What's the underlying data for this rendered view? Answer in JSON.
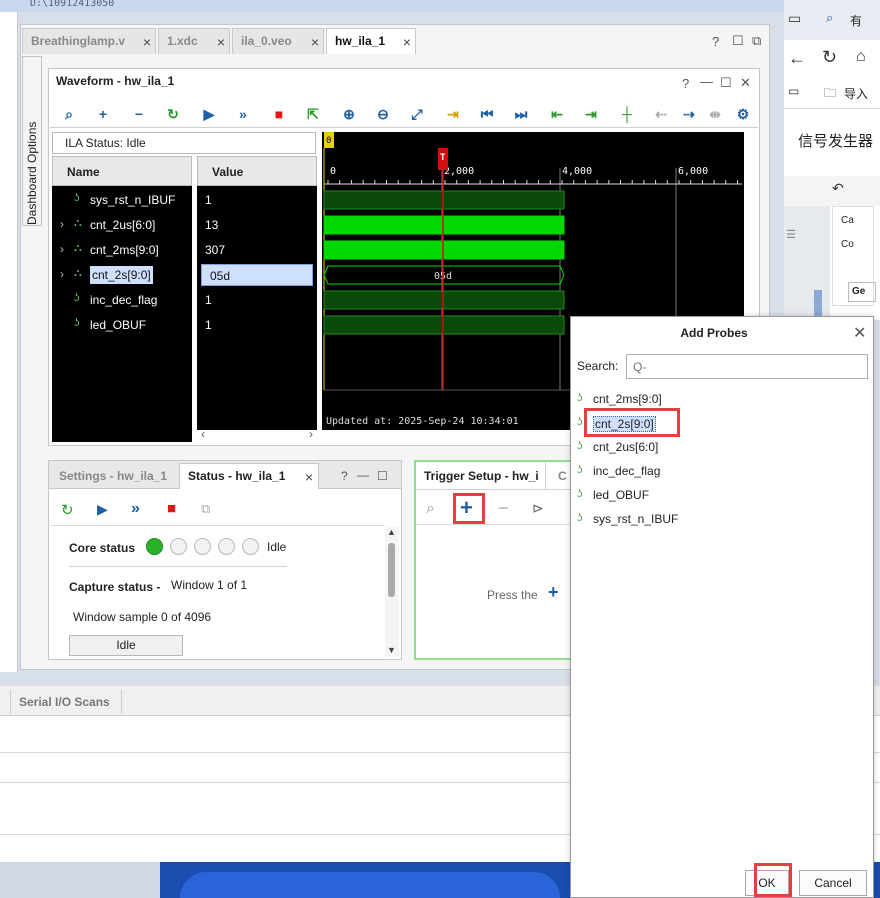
{
  "window": {
    "title_fragment": "D:\\10912413050"
  },
  "tabs": [
    {
      "label": "Breathinglamp.v"
    },
    {
      "label": "1.xdc"
    },
    {
      "label": "ila_0.veo"
    },
    {
      "label": "hw_ila_1"
    }
  ],
  "sidebar": {
    "dashboard_label": "Dashboard Options"
  },
  "waveform": {
    "title": "Waveform - hw_ila_1",
    "ila_status": "ILA Status: Idle",
    "name_header": "Name",
    "value_header": "Value",
    "signals": [
      {
        "name": "sys_rst_n_IBUF",
        "value": "1",
        "expandable": false
      },
      {
        "name": "cnt_2us[6:0]",
        "value": "13",
        "expandable": true
      },
      {
        "name": "cnt_2ms[9:0]",
        "value": "307",
        "expandable": true
      },
      {
        "name": "cnt_2s[9:0]",
        "value": "05d",
        "expandable": true
      },
      {
        "name": "inc_dec_flag",
        "value": "1",
        "expandable": false
      },
      {
        "name": "led_OBUF",
        "value": "1",
        "expandable": false
      }
    ],
    "marker_label": "0",
    "trigger_marker": "T",
    "time_ticks": [
      "0",
      "2,000",
      "4,000",
      "6,000"
    ],
    "bus_value_label": "05d",
    "updated_at": "Updated at: 2025-Sep-24 10:34:01"
  },
  "settings_panel": {
    "tab_settings": "Settings - hw_ila_1",
    "tab_status": "Status - hw_ila_1",
    "core_status_label": "Core status",
    "core_status_value": "Idle",
    "capture_status_label": "Capture status -",
    "capture_status_value": "Window 1 of 1",
    "window_sample": "Window sample 0 of 4096",
    "idle_button": "Idle"
  },
  "trigger_panel": {
    "title": "Trigger Setup - hw_i",
    "next_tab": "C",
    "hint": "Press the"
  },
  "bottom": {
    "tab_label": "Serial I/O Scans"
  },
  "browser": {
    "tab_partial": "有",
    "import_label": "导入",
    "heading": "信号发生器",
    "items": [
      "Ca",
      "Co",
      "Ge"
    ]
  },
  "dialog": {
    "title": "Add Probes",
    "search_label": "Search:",
    "search_placeholder": "Q-",
    "probes": [
      "cnt_2ms[9:0]",
      "cnt_2s[9:0]",
      "cnt_2us[6:0]",
      "inc_dec_flag",
      "led_OBUF",
      "sys_rst_n_IBUF"
    ],
    "selected_probe": "cnt_2s[9:0]",
    "ok_label": "OK",
    "cancel_label": "Cancel"
  },
  "colors": {
    "accent_blue": "#1f5fa8",
    "wave_green": "#00dd00",
    "selection": "#cfe0ff",
    "highlight_red": "#e0403e"
  }
}
